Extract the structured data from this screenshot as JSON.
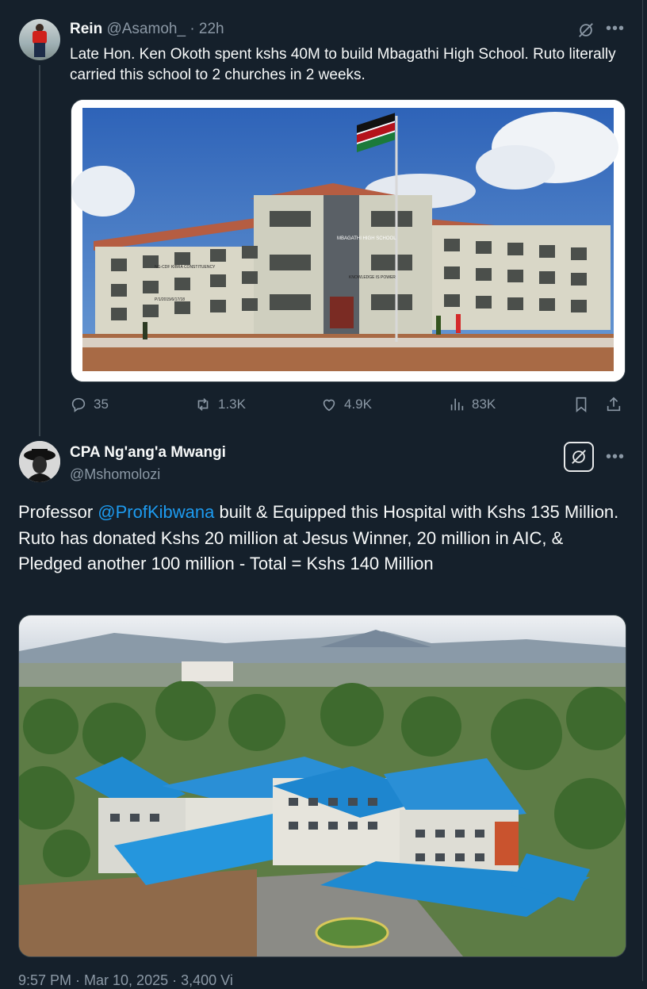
{
  "tweet1": {
    "name": "Rein",
    "handle": "@Asamoh_",
    "separator": "·",
    "time": "22h",
    "text": "Late Hon. Ken Okoth spent kshs 40M to build Mbagathi High School. Ruto literally carried this school to 2 churches in 2 weeks.",
    "image_sign_name": "MBAGATHI HIGH SCHOOL",
    "image_sign_motto": "KNOWLEDGE IS POWER",
    "image_sign_cdf": "NG-CDF KIBRA CONSTITUENCY",
    "image_sign_number": "P/1/2015/6/17/18",
    "actions": {
      "replies": "35",
      "reposts": "1.3K",
      "likes": "4.9K",
      "views": "83K"
    },
    "icons": [
      "grok-icon",
      "more-icon",
      "reply-icon",
      "repost-icon",
      "like-icon",
      "views-icon",
      "bookmark-icon",
      "share-icon"
    ]
  },
  "tweet2": {
    "name": "CPA Ng'ang'a Mwangi",
    "handle": "@Mshomolozi",
    "text_prefix": "Professor ",
    "mention": "@ProfKibwana",
    "text_line1_rest": " built & Equipped this Hospital with Kshs 135 Million.",
    "text_line2": "Ruto has donated Kshs 20 million at Jesus Winner, 20 million in AIC, & Pledged another 100 million - Total = Kshs 140 Million",
    "footer": "9:57 PM · Mar 10, 2025 · 3,400 Vi",
    "icons": [
      "grok-icon",
      "more-icon"
    ]
  },
  "colors": {
    "background": "#15202b",
    "text": "#f7f9f9",
    "muted": "#8b98a5",
    "link": "#1d9bf0",
    "border": "#38444d"
  }
}
